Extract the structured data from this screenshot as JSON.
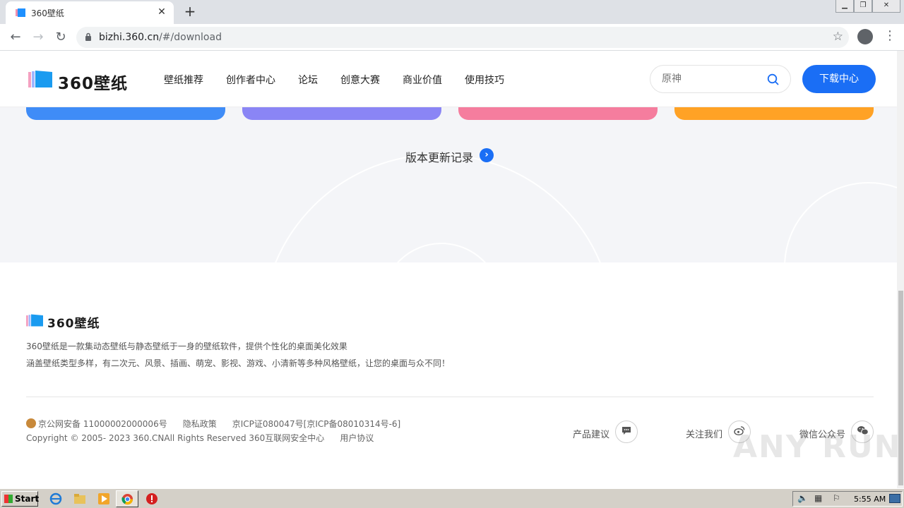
{
  "browser": {
    "tab_title": "360壁纸",
    "new_tab_label": "+",
    "close_tab_label": "✕",
    "url_host": "bizhi.360.cn",
    "url_path": "/#/download"
  },
  "header": {
    "logo_text": "360壁纸",
    "nav": [
      "壁纸推荐",
      "创作者中心",
      "论坛",
      "创意大赛",
      "商业价值",
      "使用技巧"
    ],
    "search_placeholder": "原神",
    "download_center_label": "下载中心"
  },
  "hero": {
    "changelog_label": "版本更新记录",
    "card_colors": [
      "#3f8cf7",
      "#8a85f5",
      "#f57d9e",
      "#ffa225"
    ]
  },
  "footer": {
    "logo_text": "360壁纸",
    "desc_line1": "360壁纸是一款集动态壁纸与静态壁纸于一身的壁纸软件，提供个性化的桌面美化效果",
    "desc_line2": "涵盖壁纸类型多样，有二次元、风景、插画、萌宠、影视、游戏、小清新等多种风格壁纸，让您的桌面与众不同！",
    "police_record": "京公网安备 11000002000006号",
    "privacy": "隐私政策",
    "icp": "京ICP证080047号[京ICP备08010314号-6]",
    "copyright": "Copyright © 2005- 2023 360.CNAll Rights Reserved 360互联网安全中心",
    "user_agreement": "用户协议",
    "social": [
      {
        "label": "产品建议",
        "icon": "message-icon"
      },
      {
        "label": "关注我们",
        "icon": "weibo-icon"
      },
      {
        "label": "微信公众号",
        "icon": "wechat-icon"
      }
    ]
  },
  "watermark": "ANY RUN",
  "taskbar": {
    "start_label": "Start",
    "clock": "5:55 AM"
  }
}
